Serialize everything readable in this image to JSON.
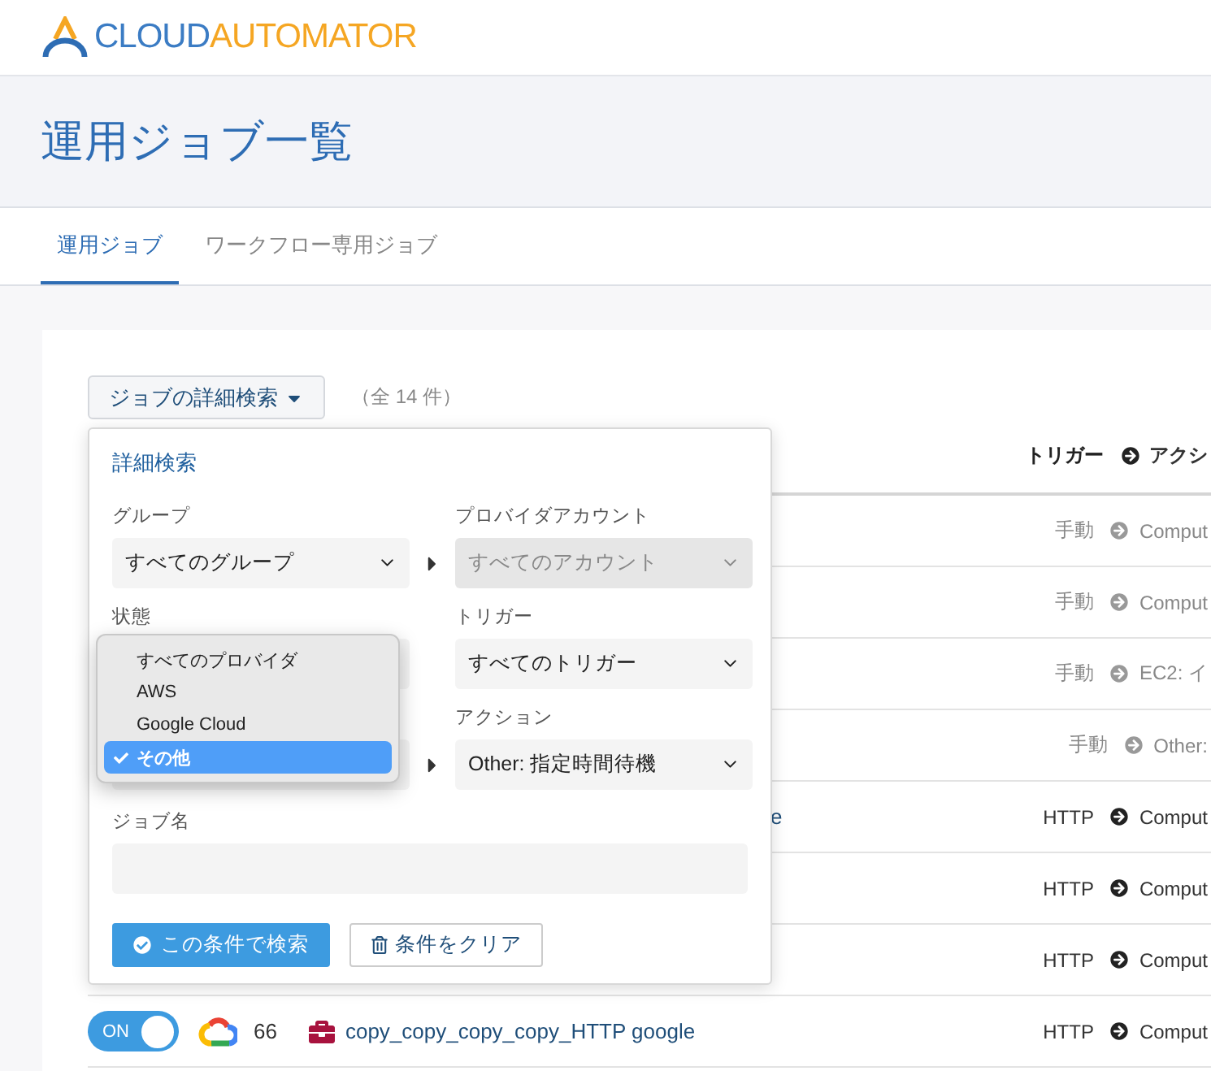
{
  "header": {
    "logo": {
      "part1": "CLOUD",
      "part2": "AUTOMATOR"
    }
  },
  "page_title": "運用ジョブ一覧",
  "tabs": [
    {
      "label": "運用ジョブ",
      "selected": true
    },
    {
      "label": "ワークフロー専用ジョブ",
      "selected": false
    }
  ],
  "toolbar": {
    "search_toggle": "ジョブの詳細検索",
    "count": "（全 14 件）"
  },
  "table": {
    "columns": [
      {
        "label": "トリガー"
      },
      {
        "label": "アクシ"
      }
    ],
    "rows": [
      {
        "disabled": true,
        "trigger": "手動",
        "action": "Comput"
      },
      {
        "disabled": true,
        "trigger": "手動",
        "action": "Comput"
      },
      {
        "disabled": true,
        "trigger": "手動",
        "action": "EC2: イ"
      },
      {
        "disabled": true,
        "trigger": "手動",
        "action": "Other:"
      },
      {
        "disabled": false,
        "name_tail": "e",
        "trigger": "HTTP",
        "action": "Comput"
      },
      {
        "disabled": false,
        "trigger": "HTTP",
        "action": "Comput"
      },
      {
        "disabled": false,
        "trigger": "HTTP",
        "action": "Comput"
      },
      {
        "disabled": false,
        "toggle": {
          "label": "ON",
          "on": true
        },
        "id": "66",
        "name": "copy_copy_copy_copy_HTTP google",
        "trigger": "HTTP",
        "action": "Comput"
      }
    ]
  },
  "search_panel": {
    "title": "詳細検索",
    "group": {
      "label": "グループ",
      "value": "すべてのグループ"
    },
    "account": {
      "label": "プロバイダアカウント",
      "value": "すべてのアカウント",
      "disabled": true
    },
    "status": {
      "label": "状態"
    },
    "trigger": {
      "label": "トリガー",
      "value": "すべてのトリガー"
    },
    "action": {
      "label": "アクション",
      "value": "Other: 指定時間待機"
    },
    "job_name": {
      "label": "ジョブ名"
    },
    "provider_menu": [
      {
        "label": "すべてのプロバイダ",
        "selected": false
      },
      {
        "label": "AWS",
        "selected": false
      },
      {
        "label": "Google Cloud",
        "selected": false
      },
      {
        "label": "その他",
        "selected": true
      }
    ],
    "search_button": "この条件で検索",
    "clear_button": "条件をクリア"
  }
}
